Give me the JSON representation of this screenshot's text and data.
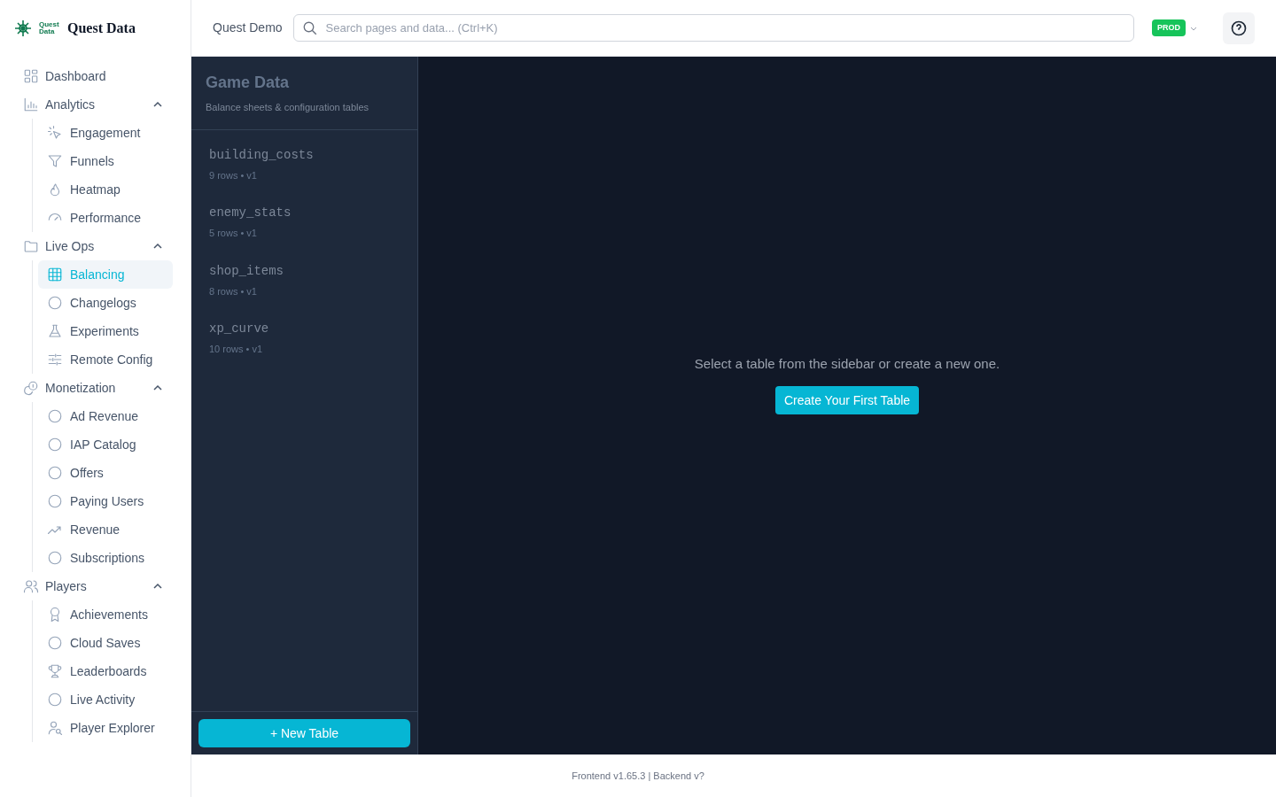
{
  "brand": {
    "mark_text": "Quest Data",
    "name": "Quest Data"
  },
  "nav": [
    {
      "label": "Dashboard"
    },
    {
      "label": "Analytics",
      "expanded": true,
      "children": [
        {
          "label": "Engagement",
          "selected": false
        },
        {
          "label": "Funnels",
          "selected": false
        },
        {
          "label": "Heatmap",
          "selected": false
        },
        {
          "label": "Performance",
          "selected": false
        }
      ]
    },
    {
      "label": "Live Ops",
      "expanded": true,
      "children": [
        {
          "label": "Balancing",
          "selected": true
        },
        {
          "label": "Changelogs",
          "selected": false
        },
        {
          "label": "Experiments",
          "selected": false
        },
        {
          "label": "Remote Config",
          "selected": false
        }
      ]
    },
    {
      "label": "Monetization",
      "expanded": true,
      "children": [
        {
          "label": "Ad Revenue",
          "selected": false
        },
        {
          "label": "IAP Catalog",
          "selected": false
        },
        {
          "label": "Offers",
          "selected": false
        },
        {
          "label": "Paying Users",
          "selected": false
        },
        {
          "label": "Revenue",
          "selected": false
        },
        {
          "label": "Subscriptions",
          "selected": false
        }
      ]
    },
    {
      "label": "Players",
      "expanded": true,
      "children": [
        {
          "label": "Achievements",
          "selected": false
        },
        {
          "label": "Cloud Saves",
          "selected": false
        },
        {
          "label": "Leaderboards",
          "selected": false
        },
        {
          "label": "Live Activity",
          "selected": false
        },
        {
          "label": "Player Explorer",
          "selected": false
        }
      ]
    }
  ],
  "header": {
    "project": "Quest Demo",
    "search": {
      "placeholder": "Search pages and data... (Ctrl+K)"
    },
    "environment": "PROD"
  },
  "panel": {
    "title": "Game Data",
    "subtitle": "Balance sheets & configuration tables",
    "tables": [
      {
        "name": "building_costs",
        "meta": "9 rows • v1"
      },
      {
        "name": "enemy_stats",
        "meta": "5 rows • v1"
      },
      {
        "name": "shop_items",
        "meta": "8 rows • v1"
      },
      {
        "name": "xp_curve",
        "meta": "10 rows • v1"
      }
    ],
    "new_button": "+ New Table"
  },
  "empty_state": {
    "message": "Select a table from the sidebar or create a new one.",
    "button": "Create Your First Table"
  },
  "footer": "Frontend v1.65.3 | Backend v?"
}
